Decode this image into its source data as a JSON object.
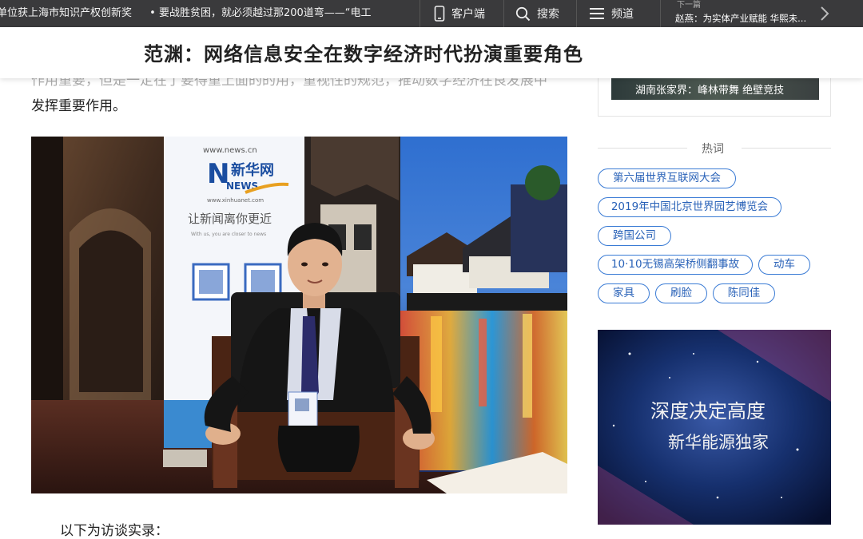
{
  "topbar": {
    "ticker": [
      "单位获上海市知识产权创新奖",
      "• 要战胜贫困，就必须越过那200道弯——“电工"
    ],
    "client_label": "客户端",
    "search_label": "搜索",
    "channel_label": "频道",
    "next_label": "下一篇",
    "next_title": "赵燕：为实体产业赋能 华熙未..."
  },
  "article": {
    "title": "范渊：网络信息安全在数字经济时代扮演重要角色",
    "cut_line": "作用重要，但是一定在了要得重上面的的用，重视性的规范，推动数字经济在良发展中",
    "para1_end": "发挥重要作用。",
    "para2": "以下为访谈实录：",
    "photo": {
      "backdrop_url": "www.news.cn",
      "backdrop_brand": "新华网",
      "backdrop_news": "NEWS",
      "backdrop_site": "www.xinhuanet.com",
      "backdrop_slogan": "让新闻离你更近",
      "backdrop_slogan_en": "With us, you are closer to news"
    }
  },
  "sidebar": {
    "top_caption": "湖南张家界：峰林带舞 绝壁竞技",
    "hot_title": "热词",
    "tags": [
      "第六届世界互联网大会",
      "2019年中国北京世界园艺博览会",
      "跨国公司",
      "10·10无锡高架桥侧翻事故",
      "动车",
      "家具",
      "刷脸",
      "陈同佳"
    ],
    "ad_line1": "深度决定高度",
    "ad_line2": "新华能源独家"
  },
  "colors": {
    "topbar_bg": "#3a3a3c",
    "tag_border": "#3a7bd5",
    "tag_text": "#2962b8"
  }
}
